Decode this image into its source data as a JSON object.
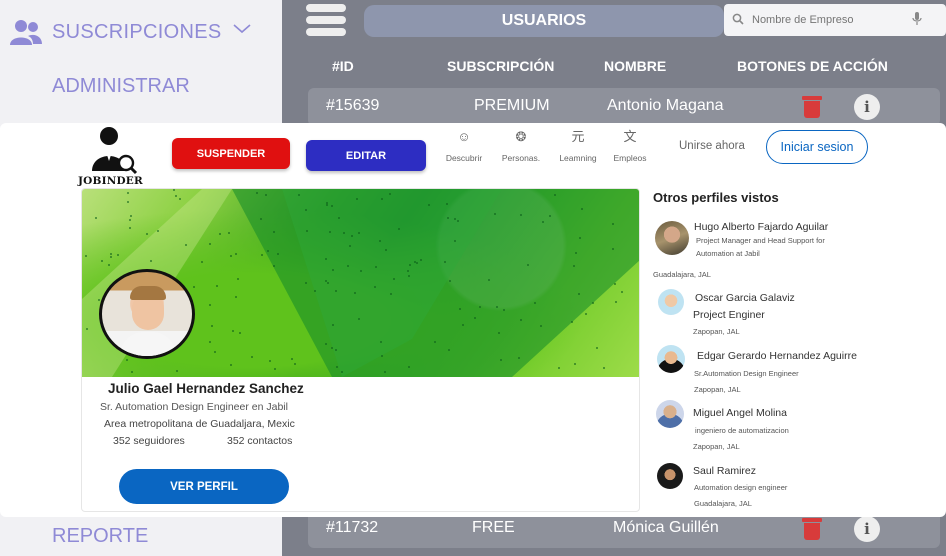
{
  "sidebar": {
    "group_label": "SUSCRIPCIONES",
    "sub_item": "ADMINISTRAR",
    "report_item": "REPORTE"
  },
  "header": {
    "title": "USUARIOS",
    "search_placeholder": "Nombre de Empreso"
  },
  "table": {
    "columns": [
      "#ID",
      "SUBSCRIPCIÓN",
      "NOMBRE",
      "BOTONES DE ACCIÓN"
    ],
    "rows": [
      {
        "id": "#15639",
        "subscription": "PREMIUM",
        "name": "Antonio Magana"
      },
      {
        "id": "#11732",
        "subscription": "FREE",
        "name": "Mónica Guillén"
      }
    ],
    "info_glyph": "i"
  },
  "modal": {
    "brand": "JOBINDER",
    "suspend_label": "SUSPENDER",
    "edit_label": "EDITAR",
    "nav": [
      {
        "label": "Descubrir",
        "icon": "compass-icon",
        "glyph": "☺"
      },
      {
        "label": "Personas.",
        "icon": "people-icon",
        "glyph": "❂"
      },
      {
        "label": "Leamning",
        "icon": "learning-icon",
        "glyph": "元"
      },
      {
        "label": "Empleos",
        "icon": "jobs-icon",
        "glyph": "文"
      }
    ],
    "join_label": "Unirse ahora",
    "login_label": "Iniciar sesion",
    "profile": {
      "name": "Julio Gael Hernandez Sanchez",
      "title": "Sr. Automation Design Engineer en Jabil",
      "location": "Area metropolitana de Guadaljara, Mexic",
      "followers": "352 seguidores",
      "contacts": "352 contactos",
      "button_label": "VER PERFIL"
    },
    "others_title": "Otros perfiles vistos",
    "others": [
      {
        "name": "Hugo Alberto Fajardo Aguilar",
        "job": "Project Manager and Head Support for",
        "job2": "Automation at Jabil",
        "location": "Guadalajara, JAL"
      },
      {
        "name": "Oscar Garcia Galaviz",
        "job": "Project Enginer",
        "job2": "",
        "location": "Zapopan, JAL"
      },
      {
        "name": "Edgar Gerardo Hernandez Aguirre",
        "job": "Sr.Automation Design Engineer",
        "job2": "",
        "location": "Zapopan, JAL"
      },
      {
        "name": "Miguel Angel Molina",
        "job": "ingeniero de automatizacion",
        "job2": "",
        "location": "Zapopan, JAL"
      },
      {
        "name": "Saul Ramirez",
        "job": "Automation design engineer",
        "job2": "",
        "location": "Guadalajara, JAL"
      }
    ]
  },
  "colors": {
    "accent_purple": "#8f8ad6",
    "suspend_red": "#e01010",
    "edit_blue": "#2d2dc2",
    "linkedin_blue": "#0a66c2",
    "main_bg": "#7c7f8a"
  }
}
